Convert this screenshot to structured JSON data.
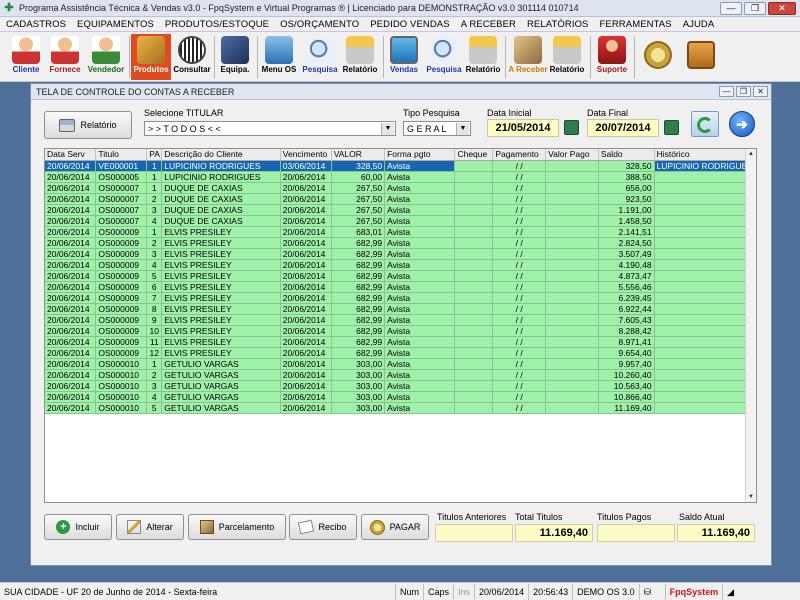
{
  "window": {
    "title": "Programa Assistência Técnica & Vendas v3.0 - FpqSystem e Virtual Programas ® | Licenciado para  DEMONSTRAÇÃO v3.0 301114 010714"
  },
  "menu": [
    "CADASTROS",
    "EQUIPAMENTOS",
    "PRODUTOS/ESTOQUE",
    "OS/ORÇAMENTO",
    "PEDIDO VENDAS",
    "A RECEBER",
    "RELATÓRIOS",
    "FERRAMENTAS",
    "AJUDA"
  ],
  "toolbar": [
    {
      "label": "Cliente",
      "icon": "user-icon"
    },
    {
      "label": "Fornece",
      "icon": "user-icon"
    },
    {
      "label": "Vendedor",
      "icon": "user-icon"
    },
    {
      "label": "Produtos",
      "icon": "boxes-icon"
    },
    {
      "label": "Consultar",
      "icon": "barcode-icon"
    },
    {
      "label": "Equipa.",
      "icon": "tools-icon"
    },
    {
      "label": "Menu OS",
      "icon": "clipboard-icon"
    },
    {
      "label": "Pesquisa",
      "icon": "magnifier-icon"
    },
    {
      "label": "Relatório",
      "icon": "printer-icon"
    },
    {
      "label": "Vendas",
      "icon": "monitor-icon"
    },
    {
      "label": "Pesquisa",
      "icon": "magnifier-icon"
    },
    {
      "label": "Relatório",
      "icon": "printer-icon"
    },
    {
      "label": "A Receber",
      "icon": "calculator-icon"
    },
    {
      "label": "Relatório",
      "icon": "printer-icon"
    },
    {
      "label": "Suporte",
      "icon": "support-icon"
    },
    {
      "label": "",
      "icon": "coins-icon"
    },
    {
      "label": "",
      "icon": "exit-icon"
    }
  ],
  "form": {
    "title": "TELA DE CONTROLE DO CONTAS A RECEBER",
    "report_button": "Relatório",
    "titular_label": "Selecione TITULAR",
    "titular_value": "> > T O D O S < <",
    "tipo_label": "Tipo  Pesquisa",
    "tipo_value": "G E R A L",
    "data_inicial_label": "Data Inicial",
    "data_inicial": "21/05/2014",
    "data_final_label": "Data Final",
    "data_final": "20/07/2014"
  },
  "grid": {
    "columns": [
      "Data Serv",
      "Titulo",
      "PA",
      "Descrição do Cliente",
      "Vencimento",
      "VALOR",
      "Forma pgto",
      "Cheque",
      "Pagamento",
      "Valor Pago",
      "Saldo",
      "Histórico"
    ],
    "rows": [
      [
        "20/06/2014",
        "VE000001",
        "1",
        "LUPICINIO RODRIGUES",
        "03/06/2014",
        "328,50",
        "Avista",
        "",
        "/ /",
        "",
        "328,50",
        "LUPICINIO RODRIGUES"
      ],
      [
        "20/06/2014",
        "OS000005",
        "1",
        "LUPICINIO RODRIGUES",
        "20/06/2014",
        "60,00",
        "Avista",
        "",
        "/ /",
        "",
        "388,50",
        ""
      ],
      [
        "20/06/2014",
        "OS000007",
        "1",
        "DUQUE DE CAXIAS",
        "20/06/2014",
        "267,50",
        "Avista",
        "",
        "/ /",
        "",
        "656,00",
        ""
      ],
      [
        "20/06/2014",
        "OS000007",
        "2",
        "DUQUE DE CAXIAS",
        "20/06/2014",
        "267,50",
        "Avista",
        "",
        "/ /",
        "",
        "923,50",
        ""
      ],
      [
        "20/06/2014",
        "OS000007",
        "3",
        "DUQUE DE CAXIAS",
        "20/06/2014",
        "267,50",
        "Avista",
        "",
        "/ /",
        "",
        "1.191,00",
        ""
      ],
      [
        "20/06/2014",
        "OS000007",
        "4",
        "DUQUE DE CAXIAS",
        "20/06/2014",
        "267,50",
        "Avista",
        "",
        "/ /",
        "",
        "1.458,50",
        ""
      ],
      [
        "20/06/2014",
        "OS000009",
        "1",
        "ELVIS PRESILEY",
        "20/06/2014",
        "683,01",
        "Avista",
        "",
        "/ /",
        "",
        "2.141,51",
        ""
      ],
      [
        "20/06/2014",
        "OS000009",
        "2",
        "ELVIS PRESILEY",
        "20/06/2014",
        "682,99",
        "Avista",
        "",
        "/ /",
        "",
        "2.824,50",
        ""
      ],
      [
        "20/06/2014",
        "OS000009",
        "3",
        "ELVIS PRESILEY",
        "20/06/2014",
        "682,99",
        "Avista",
        "",
        "/ /",
        "",
        "3.507,49",
        ""
      ],
      [
        "20/06/2014",
        "OS000009",
        "4",
        "ELVIS PRESILEY",
        "20/06/2014",
        "682,99",
        "Avista",
        "",
        "/ /",
        "",
        "4.190,48",
        ""
      ],
      [
        "20/06/2014",
        "OS000009",
        "5",
        "ELVIS PRESILEY",
        "20/06/2014",
        "682,99",
        "Avista",
        "",
        "/ /",
        "",
        "4.873,47",
        ""
      ],
      [
        "20/06/2014",
        "OS000009",
        "6",
        "ELVIS PRESILEY",
        "20/06/2014",
        "682,99",
        "Avista",
        "",
        "/ /",
        "",
        "5.556,46",
        ""
      ],
      [
        "20/06/2014",
        "OS000009",
        "7",
        "ELVIS PRESILEY",
        "20/06/2014",
        "682,99",
        "Avista",
        "",
        "/ /",
        "",
        "6.239,45",
        ""
      ],
      [
        "20/06/2014",
        "OS000009",
        "8",
        "ELVIS PRESILEY",
        "20/06/2014",
        "682,99",
        "Avista",
        "",
        "/ /",
        "",
        "6.922,44",
        ""
      ],
      [
        "20/06/2014",
        "OS000009",
        "9",
        "ELVIS PRESILEY",
        "20/06/2014",
        "682,99",
        "Avista",
        "",
        "/ /",
        "",
        "7.605,43",
        ""
      ],
      [
        "20/06/2014",
        "OS000009",
        "10",
        "ELVIS PRESILEY",
        "20/06/2014",
        "682,99",
        "Avista",
        "",
        "/ /",
        "",
        "8.288,42",
        ""
      ],
      [
        "20/06/2014",
        "OS000009",
        "11",
        "ELVIS PRESILEY",
        "20/06/2014",
        "682,99",
        "Avista",
        "",
        "/ /",
        "",
        "8.971,41",
        ""
      ],
      [
        "20/06/2014",
        "OS000009",
        "12",
        "ELVIS PRESILEY",
        "20/06/2014",
        "682,99",
        "Avista",
        "",
        "/ /",
        "",
        "9.654,40",
        ""
      ],
      [
        "20/06/2014",
        "OS000010",
        "1",
        "GETULIO VARGAS",
        "20/06/2014",
        "303,00",
        "Avista",
        "",
        "/ /",
        "",
        "9.957,40",
        ""
      ],
      [
        "20/06/2014",
        "OS000010",
        "2",
        "GETULIO VARGAS",
        "20/06/2014",
        "303,00",
        "Avista",
        "",
        "/ /",
        "",
        "10.260,40",
        ""
      ],
      [
        "20/06/2014",
        "OS000010",
        "3",
        "GETULIO VARGAS",
        "20/06/2014",
        "303,00",
        "Avista",
        "",
        "/ /",
        "",
        "10.563,40",
        ""
      ],
      [
        "20/06/2014",
        "OS000010",
        "4",
        "GETULIO VARGAS",
        "20/06/2014",
        "303,00",
        "Avista",
        "",
        "/ /",
        "",
        "10.866,40",
        ""
      ],
      [
        "20/06/2014",
        "OS000010",
        "5",
        "GETULIO VARGAS",
        "20/06/2014",
        "303,00",
        "Avista",
        "",
        "/ /",
        "",
        "11.169,40",
        ""
      ]
    ]
  },
  "actions": {
    "incluir": "Incluir",
    "alterar": "Alterar",
    "parcelamento": "Parcelamento",
    "recibo": "Recibo",
    "pagar": "PAGAR"
  },
  "totals": {
    "anteriores_label": "Titulos Anteriores",
    "anteriores_value": "",
    "total_label": "Total Titulos",
    "total_value": "11.169,40",
    "pagos_label": "Titulos Pagos",
    "pagos_value": "",
    "saldo_label": "Saldo Atual",
    "saldo_value": "11.169,40"
  },
  "status": {
    "city": "SUA CIDADE - UF 20 de Junho de 2014 - Sexta-feira",
    "num": "Num",
    "caps": "Caps",
    "ins": "Ins",
    "date": "20/06/2014",
    "time": "20:56:43",
    "version": "DEMO OS 3.0",
    "brand": "FpqSystem"
  },
  "colors": {
    "row_bg": "#9ff0a9",
    "selected": "#1566b3",
    "date_field": "#fdfbc4",
    "desktop": "#4e6f98"
  }
}
